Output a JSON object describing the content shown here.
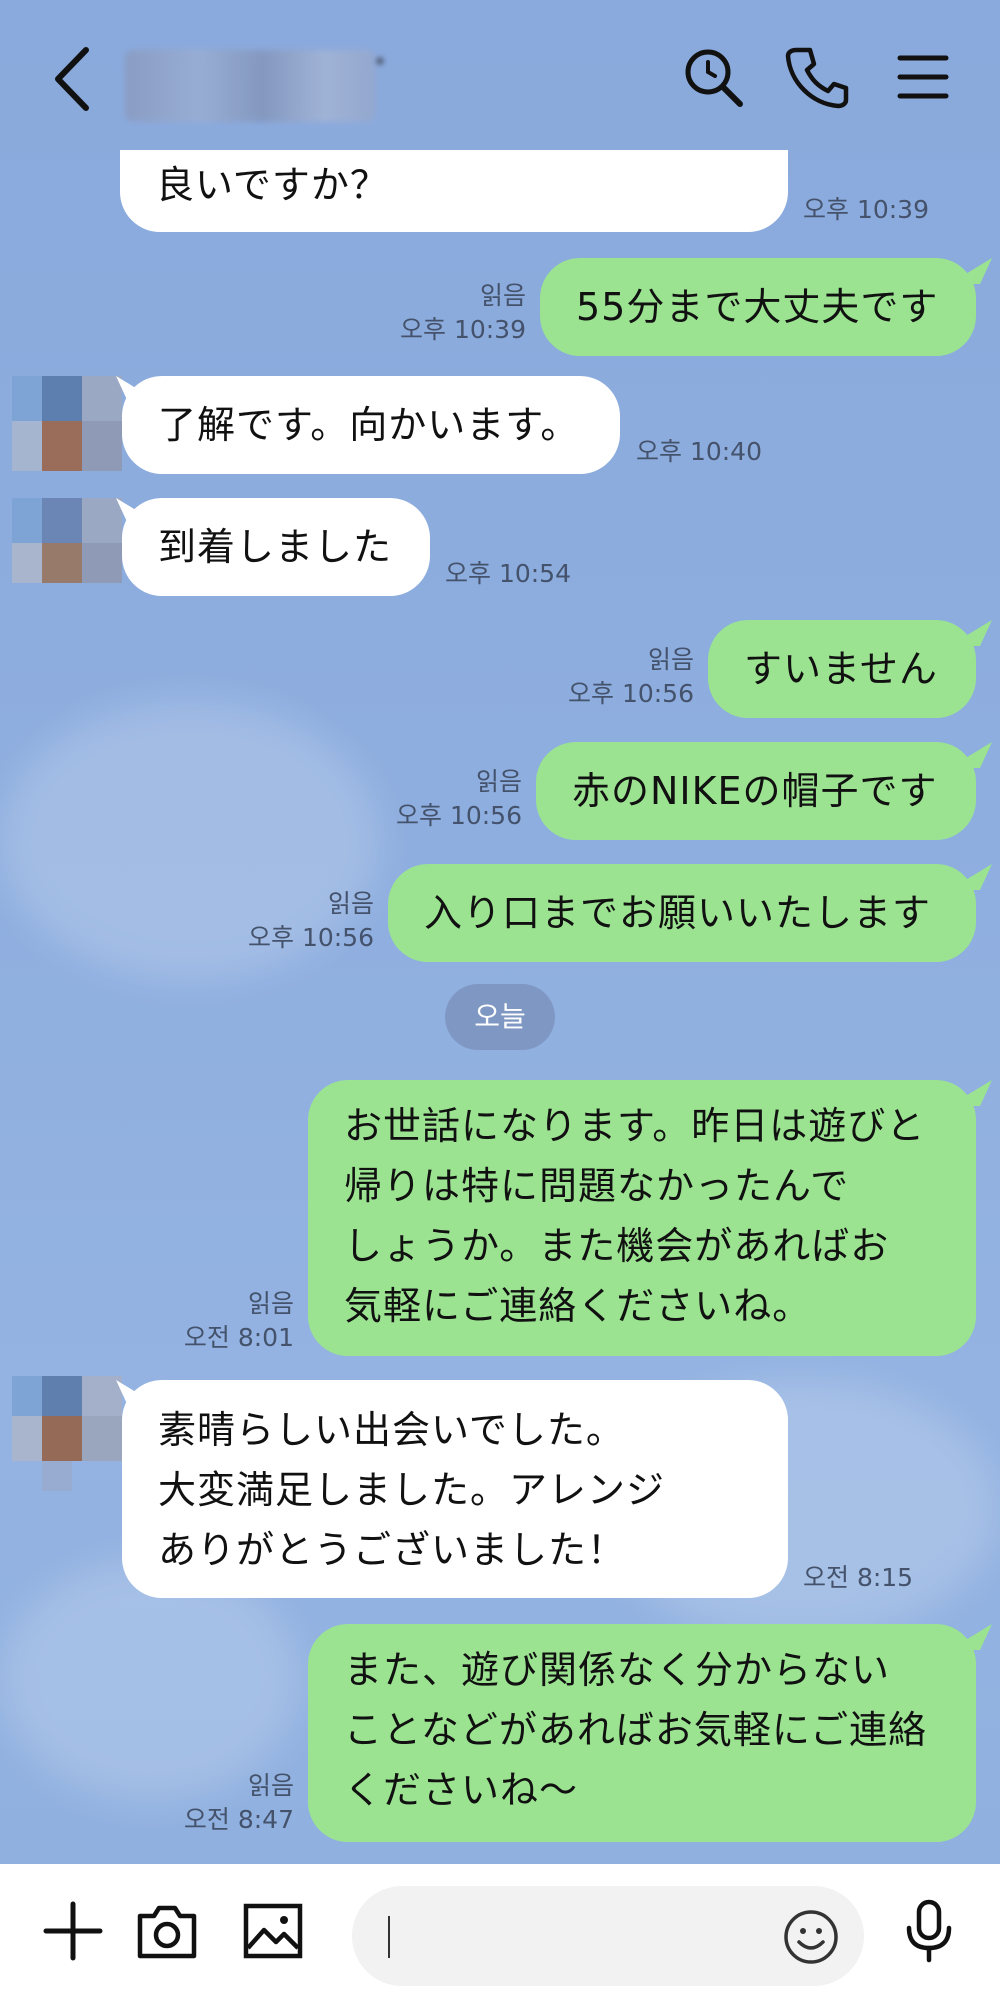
{
  "header": {
    "contact_name": ""
  },
  "messages": {
    "m1": {
      "text": "良いですか？",
      "time": "오후 10:39"
    },
    "m2": {
      "text": "55分まで大丈夫です",
      "read": "읽음",
      "time": "오후 10:39"
    },
    "m3": {
      "text": "了解です。向かいます。",
      "time": "오후 10:40"
    },
    "m4": {
      "text": "到着しました",
      "time": "오후 10:54"
    },
    "m5": {
      "text": "すいません",
      "read": "읽음",
      "time": "오후 10:56"
    },
    "m6": {
      "text": "赤のNIKEの帽子です",
      "read": "읽음",
      "time": "오후 10:56"
    },
    "m7": {
      "text": "入り口までお願いいたします",
      "read": "읽음",
      "time": "오후 10:56"
    },
    "date_divider": "오늘",
    "m8": {
      "lines": [
        "お世話になります。昨日は遊びと",
        "帰りは特に問題なかったんで",
        "しょうか。また機会があればお",
        "気軽にご連絡くださいね。"
      ],
      "read": "읽음",
      "time": "오전 8:01"
    },
    "m9": {
      "lines": [
        "素晴らしい出会いでした。",
        "大変満足しました。アレンジ",
        "ありがとうございました！"
      ],
      "time": "오전 8:15"
    },
    "m10": {
      "lines": [
        "また、遊び関係なく分からない",
        "ことなどがあればお気軽にご連絡",
        "くださいね〜"
      ],
      "read": "읽음",
      "time": "오전 8:47"
    }
  },
  "input": {
    "placeholder": ""
  },
  "colors": {
    "background": "#8eaedf",
    "outgoing_bubble": "#9be391",
    "incoming_bubble": "#ffffff"
  },
  "icons": [
    "back-icon",
    "search-icon",
    "phone-icon",
    "menu-icon",
    "plus-icon",
    "camera-icon",
    "image-icon",
    "emoji-icon",
    "mic-icon"
  ]
}
